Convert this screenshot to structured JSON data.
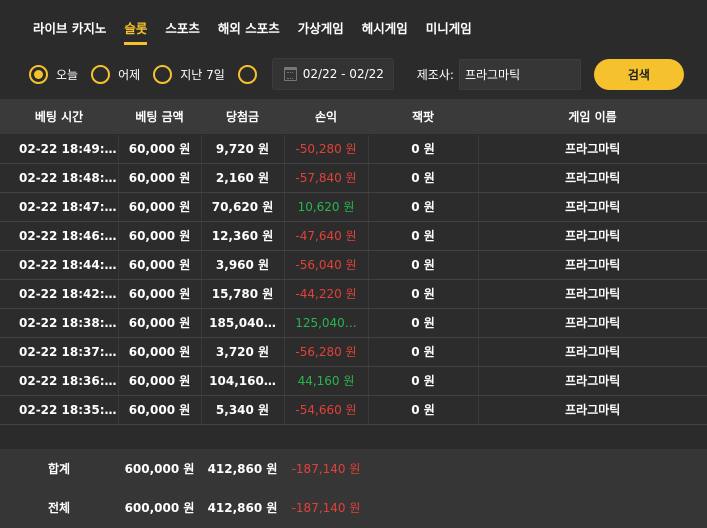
{
  "tabs": [
    {
      "label": "라이브 카지노",
      "active": false
    },
    {
      "label": "슬롯",
      "active": true
    },
    {
      "label": "스포츠",
      "active": false
    },
    {
      "label": "해외 스포츠",
      "active": false
    },
    {
      "label": "가상게임",
      "active": false
    },
    {
      "label": "헤시게임",
      "active": false
    },
    {
      "label": "미니게임",
      "active": false
    }
  ],
  "filter": {
    "today": "오늘",
    "yesterday": "어제",
    "last7": "지난 7일",
    "date_range": "02/22 - 02/22",
    "maker_label": "제조사:",
    "maker_value": "프라그마틱",
    "search_label": "검색"
  },
  "table": {
    "headers": [
      "베팅 시간",
      "베팅 금액",
      "당첨금",
      "손익",
      "잭팟",
      "게임 이름"
    ],
    "rows": [
      {
        "time": "02-22 18:49:…",
        "bet": "60,000 원",
        "win": "9,720 원",
        "profit": "-50,280 원",
        "jackpot": "0 원",
        "game": "프라그마틱",
        "sign": "neg"
      },
      {
        "time": "02-22 18:48:…",
        "bet": "60,000 원",
        "win": "2,160 원",
        "profit": "-57,840 원",
        "jackpot": "0 원",
        "game": "프라그마틱",
        "sign": "neg"
      },
      {
        "time": "02-22 18:47:…",
        "bet": "60,000 원",
        "win": "70,620 원",
        "profit": "10,620 원",
        "jackpot": "0 원",
        "game": "프라그마틱",
        "sign": "pos"
      },
      {
        "time": "02-22 18:46:…",
        "bet": "60,000 원",
        "win": "12,360 원",
        "profit": "-47,640 원",
        "jackpot": "0 원",
        "game": "프라그마틱",
        "sign": "neg"
      },
      {
        "time": "02-22 18:44:…",
        "bet": "60,000 원",
        "win": "3,960 원",
        "profit": "-56,040 원",
        "jackpot": "0 원",
        "game": "프라그마틱",
        "sign": "neg"
      },
      {
        "time": "02-22 18:42:…",
        "bet": "60,000 원",
        "win": "15,780 원",
        "profit": "-44,220 원",
        "jackpot": "0 원",
        "game": "프라그마틱",
        "sign": "neg"
      },
      {
        "time": "02-22 18:38:…",
        "bet": "60,000 원",
        "win": "185,040…",
        "profit": "125,040…",
        "jackpot": "0 원",
        "game": "프라그마틱",
        "sign": "pos"
      },
      {
        "time": "02-22 18:37:…",
        "bet": "60,000 원",
        "win": "3,720 원",
        "profit": "-56,280 원",
        "jackpot": "0 원",
        "game": "프라그마틱",
        "sign": "neg"
      },
      {
        "time": "02-22 18:36:…",
        "bet": "60,000 원",
        "win": "104,160…",
        "profit": "44,160 원",
        "jackpot": "0 원",
        "game": "프라그마틱",
        "sign": "pos"
      },
      {
        "time": "02-22 18:35:…",
        "bet": "60,000 원",
        "win": "5,340 원",
        "profit": "-54,660 원",
        "jackpot": "0 원",
        "game": "프라그마틱",
        "sign": "neg"
      }
    ]
  },
  "summary": {
    "subtotal": {
      "label": "합계",
      "bet": "600,000 원",
      "win": "412,860 원",
      "profit": "-187,140 원"
    },
    "total": {
      "label": "전체",
      "bet": "600,000 원",
      "win": "412,860 원",
      "profit": "-187,140 원"
    }
  },
  "colors": {
    "accent": "#f5c22e",
    "negative": "#e0413a",
    "positive": "#27b64d"
  }
}
